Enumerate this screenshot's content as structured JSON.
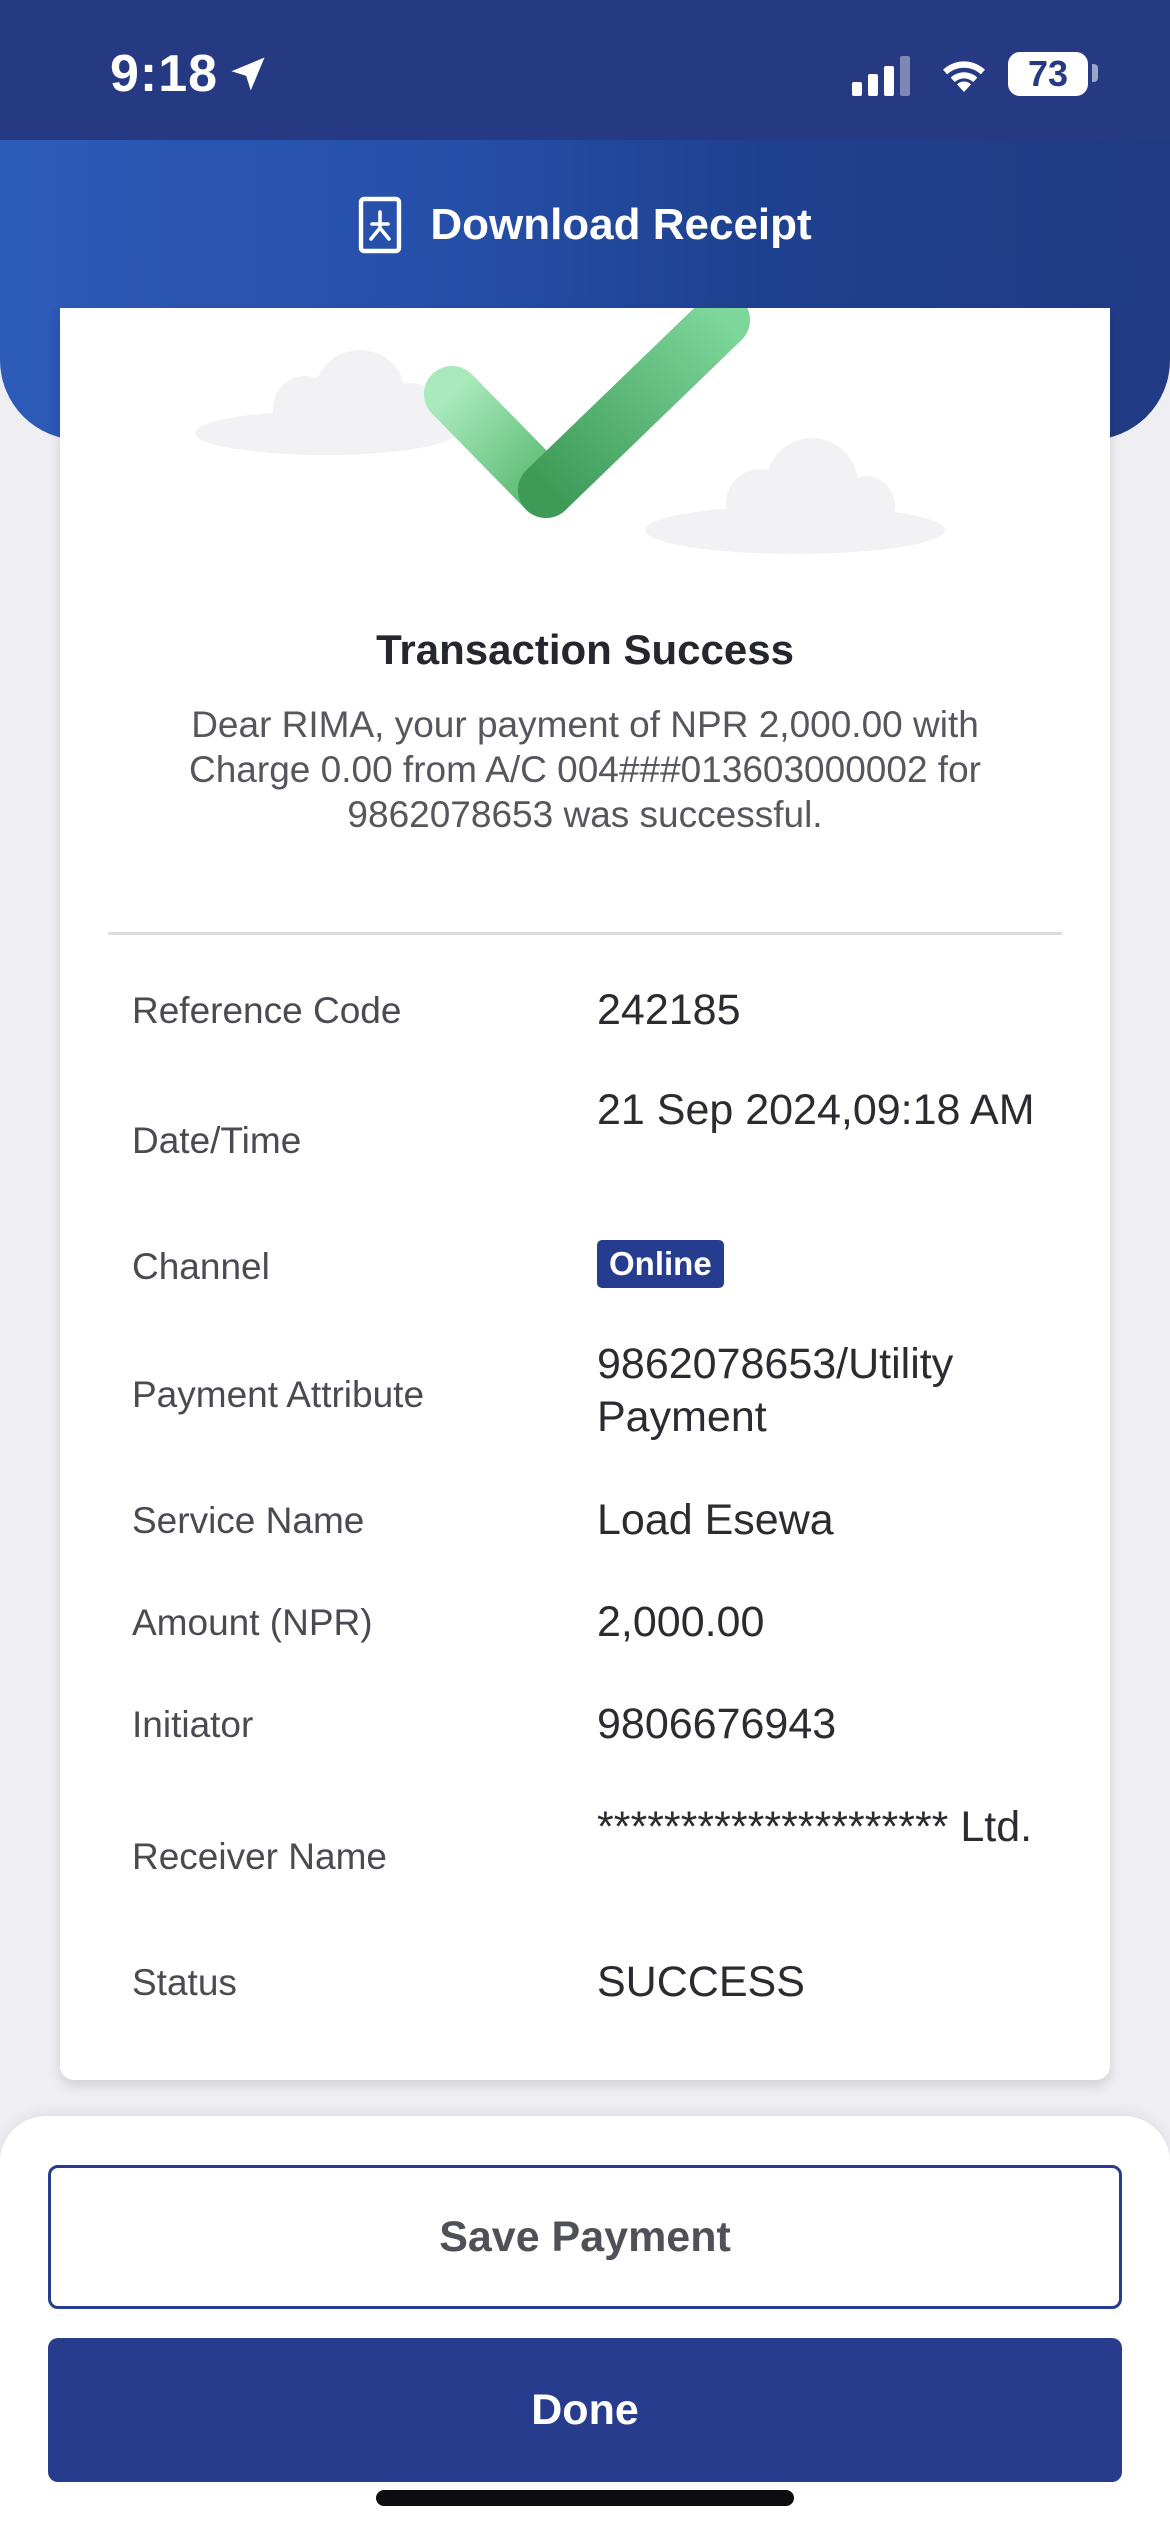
{
  "status_bar": {
    "time": "9:18",
    "battery_level": "73",
    "icons": [
      "location-arrow-icon",
      "cellular-signal-icon",
      "wifi-icon",
      "battery-icon"
    ]
  },
  "header": {
    "download_label": "Download Receipt",
    "icon": "pdf-document-icon"
  },
  "receipt": {
    "status_icon": "success-checkmark-icon",
    "title": "Transaction Success",
    "message": "Dear RIMA, your payment of NPR 2,000.00 with Charge 0.00 from A/C 004###013603000002 for 9862078653 was successful.",
    "details": [
      {
        "label": "Reference Code",
        "value": "242185"
      },
      {
        "label": "Date/Time",
        "value": "21 Sep 2024,09:18 AM"
      },
      {
        "label": "Channel",
        "value": "Online"
      },
      {
        "label": "Payment Attribute",
        "value": "9862078653/Utility Payment"
      },
      {
        "label": "Service Name",
        "value": "Load Esewa"
      },
      {
        "label": "Amount (NPR)",
        "value": "2,000.00"
      },
      {
        "label": "Initiator",
        "value": "9806676943"
      },
      {
        "label": "Receiver Name",
        "value": "********************* Ltd."
      },
      {
        "label": "Status",
        "value": "SUCCESS"
      }
    ]
  },
  "actions": {
    "save_label": "Save Payment",
    "done_label": "Done"
  },
  "colors": {
    "primary": "#263c8e",
    "header_gradient_start": "#2d5bb8",
    "success_green": "#4caf6a",
    "background": "#eeeef3"
  }
}
